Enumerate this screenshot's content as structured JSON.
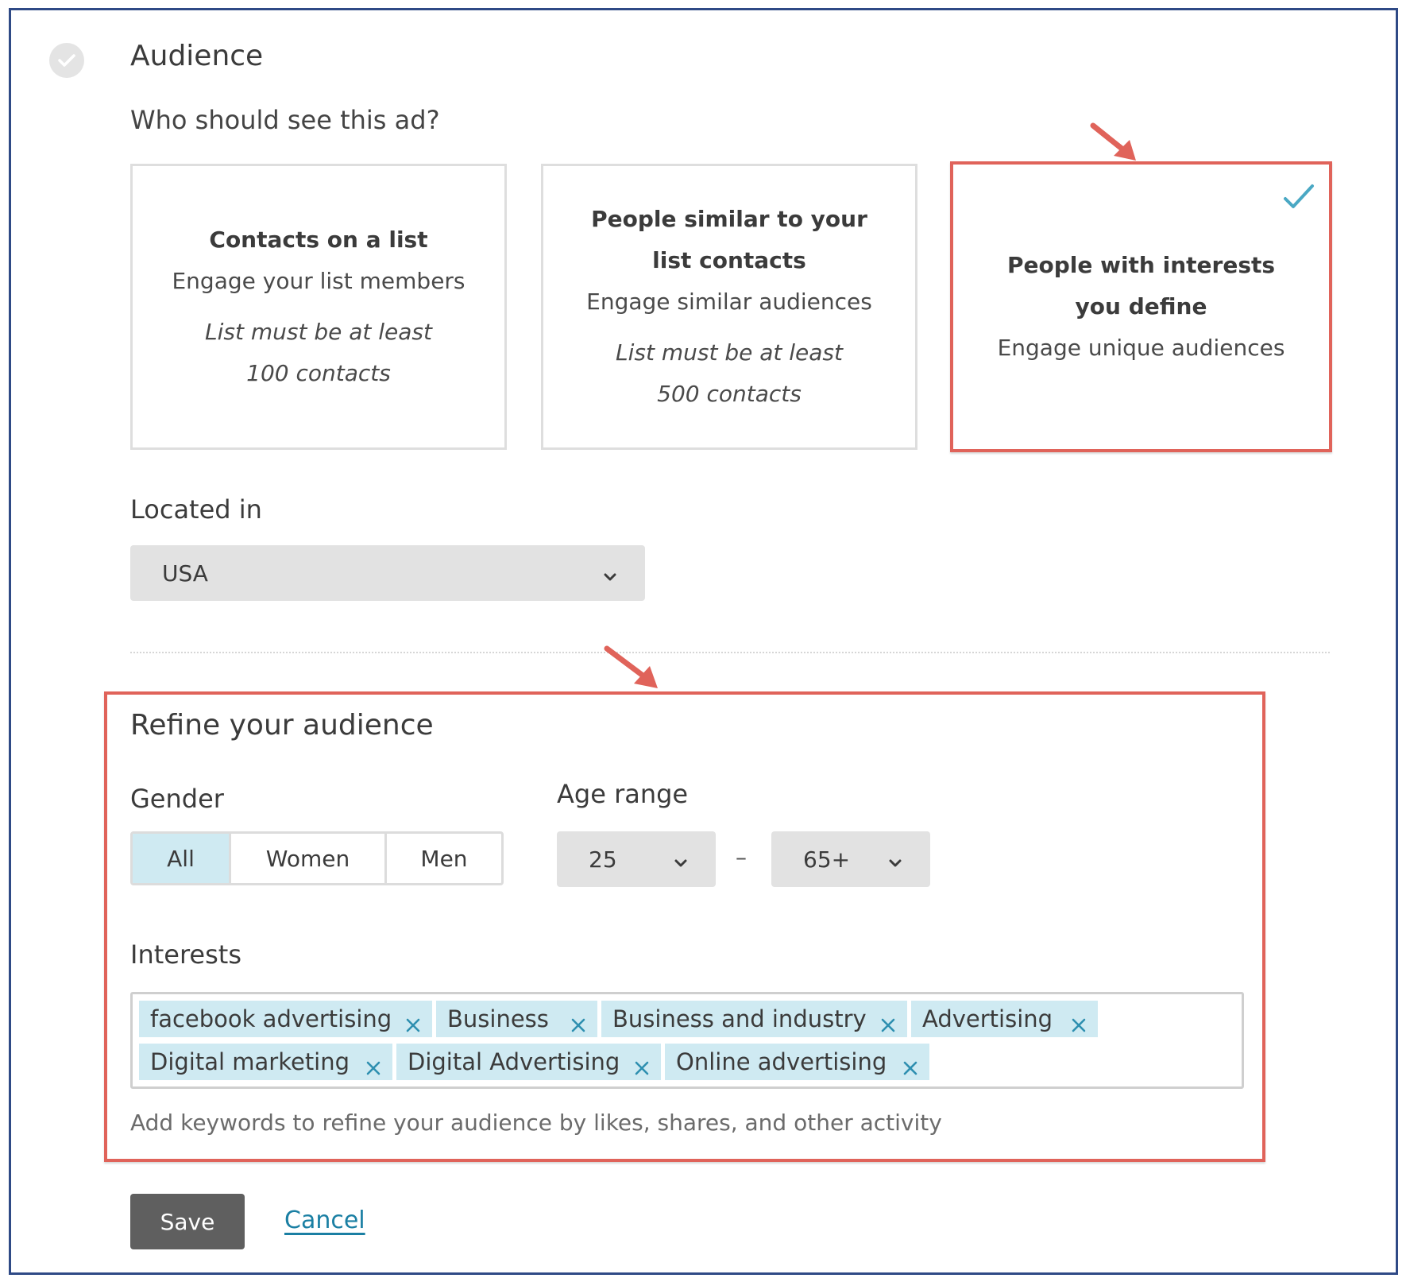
{
  "audience": {
    "title": "Audience",
    "question": "Who should see this ad?"
  },
  "cards": [
    {
      "title": "Contacts on a list",
      "description": "Engage your list members",
      "note": "List must be at least 100 contacts",
      "selected": false
    },
    {
      "title": "People similar to your list contacts",
      "description": "Engage similar audiences",
      "note": "List must be at least 500 contacts",
      "selected": false
    },
    {
      "title": "People with interests you define",
      "description": "Engage unique audiences",
      "selected": true
    }
  ],
  "location": {
    "label": "Located in",
    "value": "USA"
  },
  "refine": {
    "title": "Refine your audience",
    "gender": {
      "label": "Gender",
      "options": [
        "All",
        "Women",
        "Men"
      ],
      "selected": "All"
    },
    "age": {
      "label": "Age range",
      "min": "25",
      "separator": "–",
      "max": "65+"
    },
    "interests": {
      "label": "Interests",
      "tags": [
        "facebook advertising",
        "Business",
        "Business and industry",
        "Advertising",
        "Digital marketing",
        "Digital Advertising",
        "Online advertising"
      ],
      "hint": "Add keywords to refine your audience by likes, shares, and other activity"
    }
  },
  "actions": {
    "save": "Save",
    "cancel": "Cancel"
  },
  "colors": {
    "highlight": "#e0635a",
    "accent": "#4aa8c4",
    "tag_bg": "#cfeaf2",
    "frame": "#2f4a86"
  }
}
